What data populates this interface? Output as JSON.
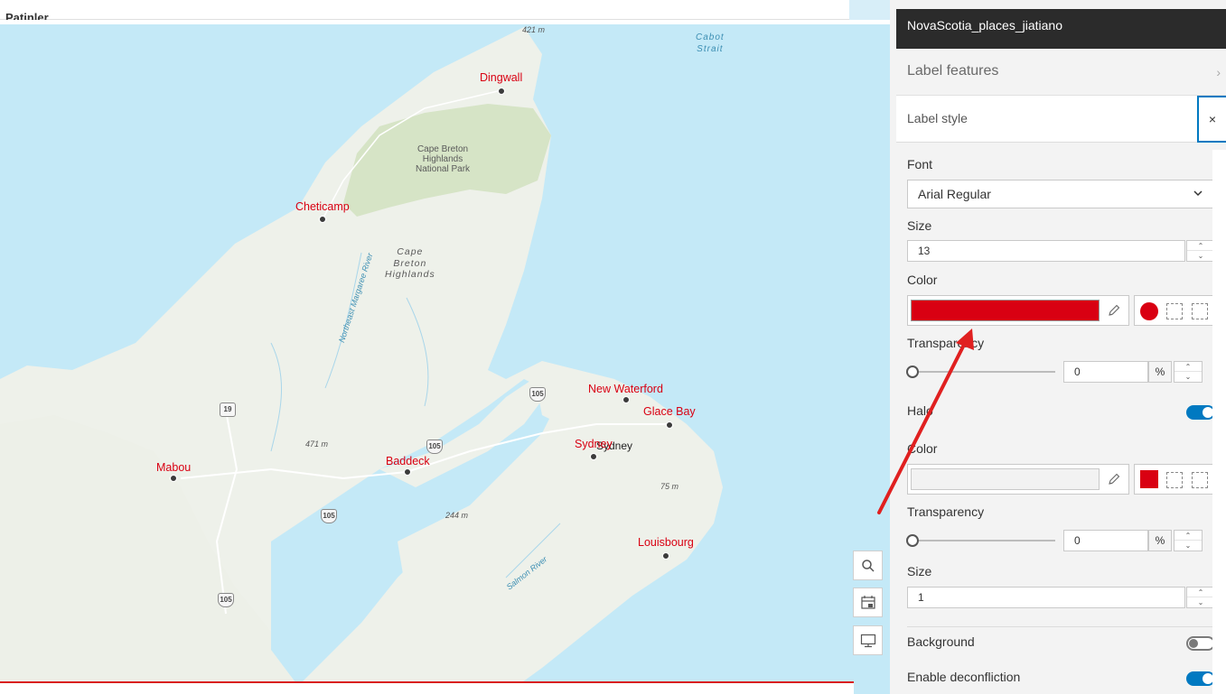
{
  "map": {
    "top_title": "Patinler",
    "cities": [
      {
        "name": "Dingwall"
      },
      {
        "name": "Cheticamp"
      },
      {
        "name": "New Waterford"
      },
      {
        "name": "Glace Bay"
      },
      {
        "name": "Sydney"
      },
      {
        "name": "Mabou"
      },
      {
        "name": "Baddeck"
      },
      {
        "name": "Louisbourg"
      }
    ],
    "sydney_base_label": "Sydney",
    "park_label": "Cape Breton\nHighlands\nNational Park",
    "highlands_label": "Cape\nBreton\nHighlands",
    "strait_label": "Cabot\nStrait",
    "river_northeast": "Northeast Margaree River",
    "river_salmon": "Salmon River",
    "elevations": [
      "421 m",
      "471 m",
      "244 m",
      "75 m"
    ],
    "route_shields": [
      "19",
      "105",
      "105",
      "105",
      "105"
    ],
    "tools": [
      {
        "icon": "search-icon"
      },
      {
        "icon": "layer-date-icon"
      },
      {
        "icon": "monitor-icon"
      }
    ]
  },
  "panel": {
    "layer_title": "NovaScotia_places_jiatiano",
    "label_features": "Label features",
    "label_style": "Label style",
    "close_label": "×",
    "font_label": "Font",
    "font_value": "Arial Regular",
    "size_label": "Size",
    "size_value": "13",
    "color_label": "Color",
    "text_color": "#d90012",
    "transparency_label": "Transparency",
    "transparency_value": "0",
    "percent_unit": "%",
    "halo_label": "Halo",
    "halo_enabled": true,
    "halo_color_label": "Color",
    "halo_color": "#f2f2f2",
    "halo_tool_color": "#d90012",
    "halo_transparency_label": "Transparency",
    "halo_transparency_value": "0",
    "halo_size_label": "Size",
    "halo_size_value": "1",
    "background_label": "Background",
    "background_enabled": false,
    "deconfliction_label": "Enable deconfliction",
    "deconfliction_enabled": true
  },
  "annotation": {
    "arrow_color": "#e02020"
  }
}
